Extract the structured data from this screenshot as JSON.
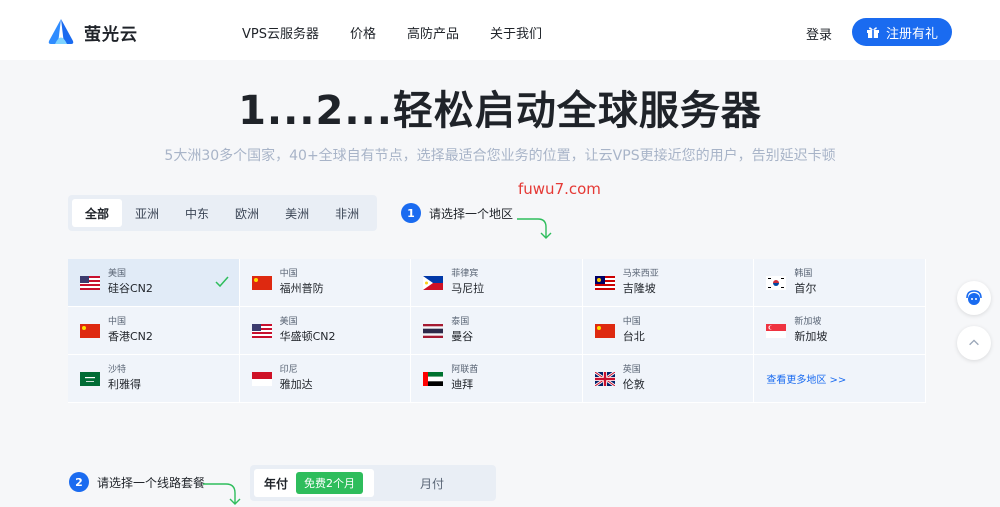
{
  "brand": {
    "name": "萤光云",
    "accent": "#1a6bf0"
  },
  "nav": {
    "links": [
      "VPS云服务器",
      "价格",
      "高防产品",
      "关于我们"
    ],
    "login": "登录",
    "register": "注册有礼"
  },
  "hero": {
    "title": "1...2...轻松启动全球服务器",
    "subtitle": "5大洲30多个国家，40+全球自有节点，选择最适合您业务的位置，让云VPS更接近您的用户，告别延迟卡顿"
  },
  "watermark": "fuwu7.com",
  "region_tabs": [
    "全部",
    "亚洲",
    "中东",
    "欧洲",
    "美洲",
    "非洲"
  ],
  "step1": {
    "num": "1",
    "label": "请选择一个地区"
  },
  "regions": [
    {
      "country": "美国",
      "city": "硅谷CN2",
      "flag": "us-flag",
      "selected": true
    },
    {
      "country": "中国",
      "city": "福州普防",
      "flag": "cn-flag"
    },
    {
      "country": "菲律宾",
      "city": "马尼拉",
      "flag": "ph-flag"
    },
    {
      "country": "马来西亚",
      "city": "吉隆坡",
      "flag": "my-flag"
    },
    {
      "country": "韩国",
      "city": "首尔",
      "flag": "kr-flag"
    },
    {
      "country": "中国",
      "city": "香港CN2",
      "flag": "cn-flag"
    },
    {
      "country": "美国",
      "city": "华盛顿CN2",
      "flag": "us-flag"
    },
    {
      "country": "泰国",
      "city": "曼谷",
      "flag": "th-flag"
    },
    {
      "country": "中国",
      "city": "台北",
      "flag": "cn-flag"
    },
    {
      "country": "新加坡",
      "city": "新加坡",
      "flag": "sg-flag"
    },
    {
      "country": "沙特",
      "city": "利雅得",
      "flag": "sa-flag"
    },
    {
      "country": "印尼",
      "city": "雅加达",
      "flag": "id-flag"
    },
    {
      "country": "阿联酋",
      "city": "迪拜",
      "flag": "ae-flag"
    },
    {
      "country": "英国",
      "city": "伦敦",
      "flag": "gb-flag"
    }
  ],
  "more_regions": "查看更多地区 >>",
  "step2": {
    "num": "2",
    "label": "请选择一个线路套餐"
  },
  "billing": {
    "year": "年付",
    "free_badge": "免费2个月",
    "month": "月付"
  }
}
